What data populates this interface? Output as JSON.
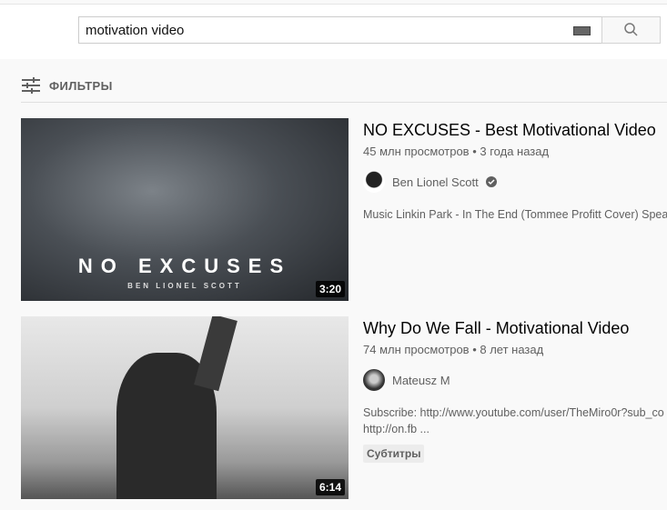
{
  "search": {
    "value": "motivation video"
  },
  "filters": {
    "label": "ФИЛЬТРЫ"
  },
  "videos": [
    {
      "title": "NO EXCUSES - Best Motivational Video",
      "views": "45 млн просмотров",
      "age": "3 года назад",
      "channel": "Ben Lionel Scott",
      "verified": true,
      "description": "Music Linkin Park - In The End (Tommee Profitt Cover) Spea",
      "duration": "3:20",
      "thumb_text": "NO EXCUSES",
      "thumb_subtext": "BEN LIONEL SCOTT"
    },
    {
      "title": "Why Do We Fall - Motivational Video",
      "views": "74 млн просмотров",
      "age": "8 лет назад",
      "channel": "Mateusz M",
      "description": "Subscribe: http://www.youtube.com/user/TheMiro0r?sub_co",
      "description2": "http://on.fb ...",
      "badge": "Субтитры",
      "duration": "6:14"
    }
  ]
}
